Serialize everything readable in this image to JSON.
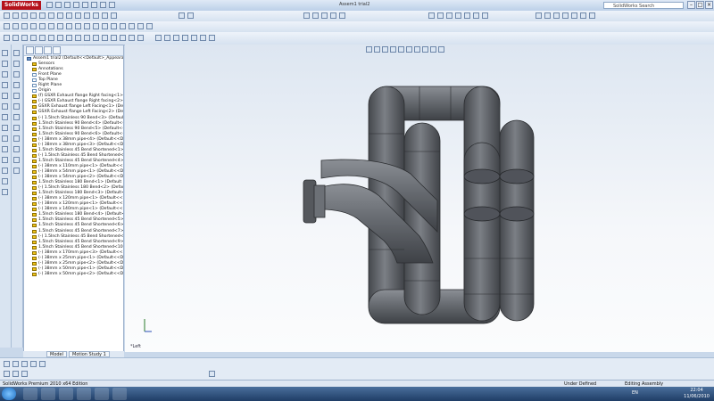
{
  "window": {
    "app_name": "SolidWorks",
    "title": "Assem1 trial2",
    "search_placeholder": "SolidWorks Search"
  },
  "tree": {
    "items": [
      {
        "label": "Assem1 trial2  (Default<<Default>_Appearan",
        "kind": "top"
      },
      {
        "label": "Sensors",
        "kind": "folder"
      },
      {
        "label": "Annotations",
        "kind": "folder"
      },
      {
        "label": "Front Plane",
        "kind": "plane"
      },
      {
        "label": "Top Plane",
        "kind": "plane"
      },
      {
        "label": "Right Plane",
        "kind": "plane"
      },
      {
        "label": "Origin",
        "kind": "plane"
      },
      {
        "label": "(f) GSXR Exhaust flange Right facing<1> (",
        "kind": "part"
      },
      {
        "label": "(-) GSXR Exhaust flange Right facing<2> (",
        "kind": "part"
      },
      {
        "label": "GSXR Exhaust flange Left Facing<1> (Def",
        "kind": "part"
      },
      {
        "label": "GSXR Exhaust flange Left Facing<2> (Def",
        "kind": "part"
      },
      {
        "label": "(-) 1.5Inch Stainless 90 Bend<3> (Default-",
        "kind": "part"
      },
      {
        "label": "1.5Inch Stainless 90 Bend<4> (Default<<",
        "kind": "part"
      },
      {
        "label": "1.5Inch Stainless 90 Bend<5> (Default<<",
        "kind": "part"
      },
      {
        "label": "1.5Inch Stainless 90 Bend<6> (Default<<",
        "kind": "part"
      },
      {
        "label": "(-) 38mm x 38mm pipe<4> (Default<<De",
        "kind": "part"
      },
      {
        "label": "(-) 38mm x 38mm pipe<3> (Default<<De",
        "kind": "part"
      },
      {
        "label": "1.5Inch Stainless 45 Bend Shortened<1> (",
        "kind": "part"
      },
      {
        "label": "(-) 1.5Inch Stainless 45 Bend Shortened<4",
        "kind": "part"
      },
      {
        "label": "1.5Inch Stainless 45 Bend Shortened<4> (",
        "kind": "part"
      },
      {
        "label": "(-) 38mm x 110mm pipe<1> (Default<<D",
        "kind": "part"
      },
      {
        "label": "(-) 38mm x 54mm pipe<1> (Default<<De",
        "kind": "part"
      },
      {
        "label": "(-) 38mm x 54mm pipe<2> (Default<<De",
        "kind": "part"
      },
      {
        "label": "1.5Inch Stainless 180 Bend<1> (Default",
        "kind": "part"
      },
      {
        "label": "(-) 1.5Inch Stainless 180 Bend<2> (Defau",
        "kind": "part"
      },
      {
        "label": "1.5Inch Stainless 180 Bend<3> (Default<",
        "kind": "part"
      },
      {
        "label": "(-) 38mm x 120mm pipe<1> (Default<<D",
        "kind": "part"
      },
      {
        "label": "(-) 38mm x 120mm pipe<1> (Default<<D",
        "kind": "part"
      },
      {
        "label": "(-) 38mm x 140mm pipe<1> (Default<<D",
        "kind": "part"
      },
      {
        "label": "1.5Inch Stainless 180 Bend<4> (Default<",
        "kind": "part"
      },
      {
        "label": "1.5Inch Stainless 45 Bend Shortened<5> (",
        "kind": "part"
      },
      {
        "label": "1.5Inch Stainless 45 Bend Shortened<6> (",
        "kind": "part"
      },
      {
        "label": "1.5Inch Stainless 45 Bend Shortened<7> (",
        "kind": "part"
      },
      {
        "label": "(-) 1.5Inch Stainless 45 Bend Shortened<8",
        "kind": "part"
      },
      {
        "label": "1.5Inch Stainless 45 Bend Shortened<9> (",
        "kind": "part"
      },
      {
        "label": "1.5Inch Stainless 45 Bend Shortened<10>",
        "kind": "part"
      },
      {
        "label": "(-) 38mm x 170mm pipe<3> (Default<<D",
        "kind": "part"
      },
      {
        "label": "(-) 38mm x 25mm pipe<1> (Default<<De",
        "kind": "part"
      },
      {
        "label": "(-) 38mm x 25mm pipe<2> (Default<<De",
        "kind": "part"
      },
      {
        "label": "(-) 38mm x 50mm pipe<1> (Default<<De",
        "kind": "part"
      },
      {
        "label": "(-) 38mm x 50mm pipe<2> (Default<<De",
        "kind": "part"
      }
    ]
  },
  "bottom_tabs": [
    "Model",
    "Motion Study 1"
  ],
  "viewport": {
    "view_label": "*Left"
  },
  "status": {
    "edition": "SolidWorks Premium 2010 x64 Edition",
    "constraint": "Under Defined",
    "mode": "Editing Assembly"
  },
  "taskbar": {
    "language": "EN",
    "time": "22:04",
    "date": "11/06/2010"
  },
  "colors": {
    "model_gray": "#5e6166",
    "brand_red": "#b5121b"
  }
}
